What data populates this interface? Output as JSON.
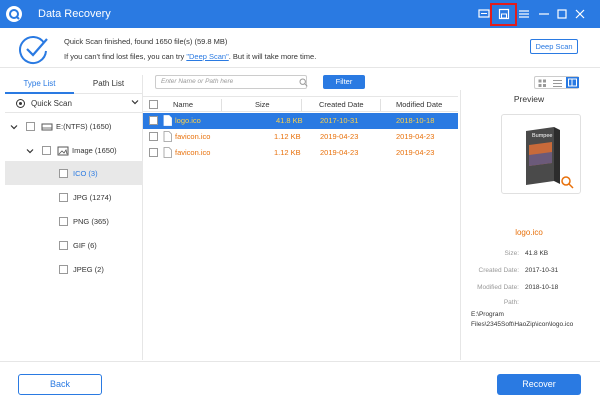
{
  "window": {
    "title": "Data Recovery",
    "accent": "#2a7ae2",
    "highlight": "#e21d1d"
  },
  "status": {
    "line1": "Quick Scan finished, found 1650 file(s) (59.8 MB)",
    "line2_prefix": "If you can't find lost files, you can try ",
    "line2_link": "\"Deep Scan\"",
    "line2_suffix": ". But it will take more time.",
    "deep_scan_label": "Deep Scan"
  },
  "sidebar": {
    "tabs": [
      "Type List",
      "Path List"
    ],
    "active_tab": "Type List",
    "scan_mode": "Quick Scan",
    "tree": [
      {
        "label": "E:(NTFS) (1650)",
        "icon": "drive-icon"
      },
      {
        "label": "Image (1650)",
        "icon": "image-icon"
      },
      {
        "label": "ICO (3)"
      },
      {
        "label": "JPG (1274)"
      },
      {
        "label": "PNG (365)"
      },
      {
        "label": "GIF (6)"
      },
      {
        "label": "JPEG (2)"
      }
    ]
  },
  "toolbar": {
    "search_placeholder": "Enter Name or Path here",
    "filter_label": "Filter"
  },
  "table": {
    "columns": [
      "Name",
      "Size",
      "Created Date",
      "Modified Date"
    ],
    "rows": [
      {
        "name": "logo.ico",
        "size": "41.8 KB",
        "created": "2017-10-31",
        "modified": "2018-10-18",
        "selected": true
      },
      {
        "name": "favicon.ico",
        "size": "1.12 KB",
        "created": "2019-04-23",
        "modified": "2019-04-23",
        "selected": false
      },
      {
        "name": "favicon.ico",
        "size": "1.12 KB",
        "created": "2019-04-23",
        "modified": "2019-04-23",
        "selected": false
      }
    ]
  },
  "preview": {
    "title": "Preview",
    "file_name": "logo.ico",
    "size_label": "Size:",
    "size_value": "41.8 KB",
    "created_label": "Created Date:",
    "created_value": "2017-10-31",
    "modified_label": "Modified Date:",
    "modified_value": "2018-10-18",
    "path_label": "Path:",
    "path_value": "E:\\Program Files\\2345Soft\\HaoZip\\icon\\logo.ico",
    "thumbnail_text": "Bumpee"
  },
  "footer": {
    "back_label": "Back",
    "recover_label": "Recover"
  }
}
